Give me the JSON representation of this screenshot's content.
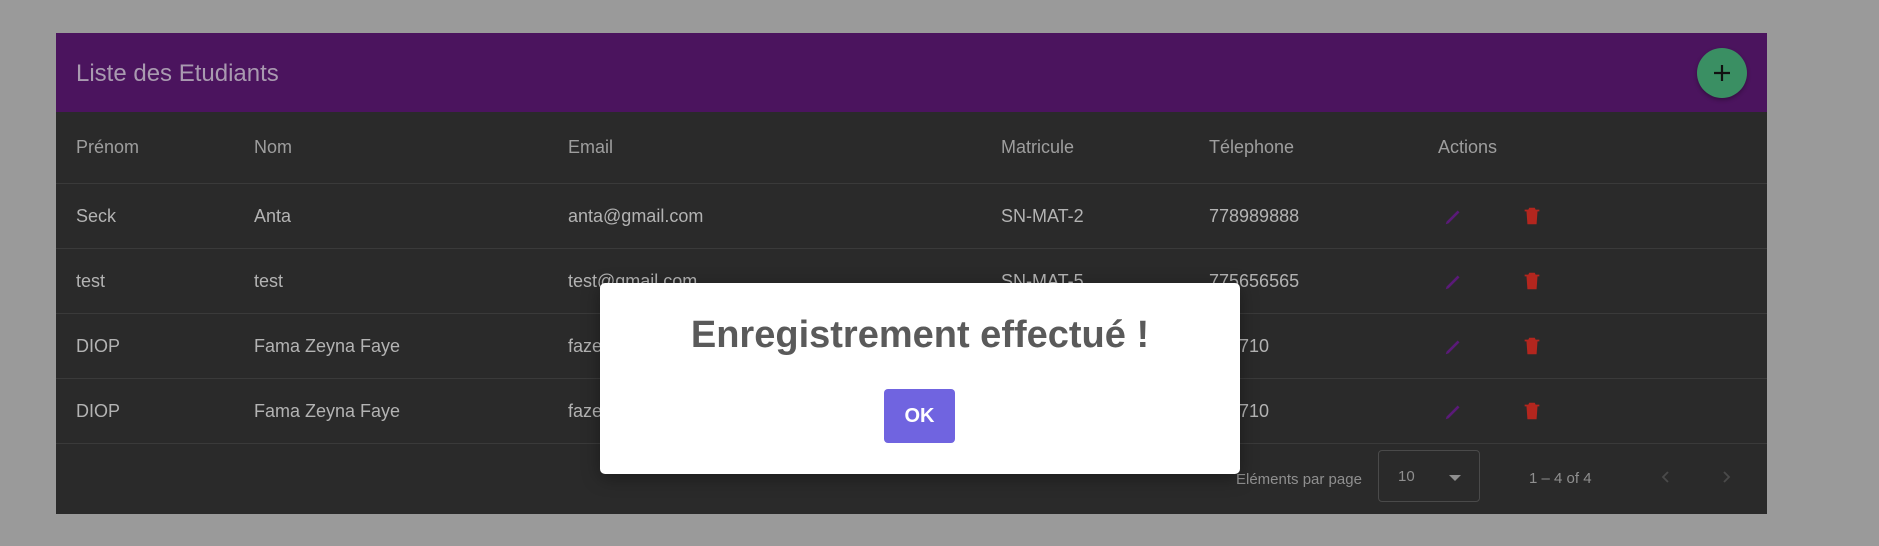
{
  "header": {
    "title": "Liste des Etudiants",
    "add_icon": "plus-icon"
  },
  "table": {
    "columns": [
      "Prénom",
      "Nom",
      "Email",
      "Matricule",
      "Télephone",
      "Actions"
    ],
    "rows": [
      {
        "prenom": "Seck",
        "nom": "Anta",
        "email": "anta@gmail.com",
        "matricule": "SN-MAT-2",
        "telephone": "778989888"
      },
      {
        "prenom": "test",
        "nom": "test",
        "email": "test@gmail.com",
        "matricule": "SN-MAT-5",
        "telephone": "775656565"
      },
      {
        "prenom": "DIOP",
        "nom": "Fama Zeyna Faye",
        "email": "faze",
        "matricule": "",
        "telephone": "143710"
      },
      {
        "prenom": "DIOP",
        "nom": "Fama Zeyna Faye",
        "email": "faze",
        "matricule": "",
        "telephone": "143710"
      }
    ],
    "action_icons": [
      "pencil-icon",
      "trash-icon"
    ]
  },
  "paginator": {
    "per_page_label": "Eléments par page",
    "per_page_value": "10",
    "range_label": "1 – 4 of 4"
  },
  "modal": {
    "title": "Enregistrement effectué !",
    "ok_label": "OK"
  },
  "colors": {
    "toolbar": "#4b145e",
    "fab": "#3a8f63",
    "edit_icon": "#5a1a78",
    "delete_icon": "#b3261e",
    "ok_button": "#7064e0"
  }
}
